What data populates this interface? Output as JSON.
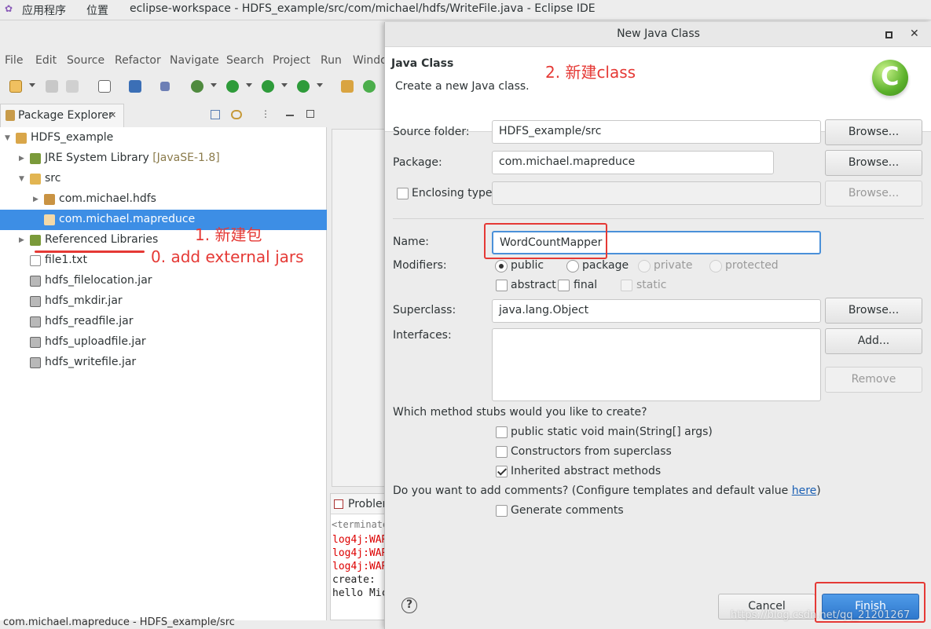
{
  "gnome": {
    "apps": "应用程序",
    "places": "位置",
    "window_title": "eclipse-workspace - HDFS_example/src/com/michael/hdfs/WriteFile.java - Eclipse IDE"
  },
  "menu": [
    "File",
    "Edit",
    "Source",
    "Refactor",
    "Navigate",
    "Search",
    "Project",
    "Run",
    "Windo"
  ],
  "package_explorer": {
    "tab_label": "Package Explorer",
    "tab_close": "✕",
    "tree": [
      {
        "label": "HDFS_example",
        "extra": "",
        "icon": "project-icon"
      },
      {
        "label": "JRE System Library",
        "extra": "[JavaSE-1.8]",
        "icon": "library-icon"
      },
      {
        "label": "src",
        "extra": "",
        "icon": "source-folder-icon"
      },
      {
        "label": "com.michael.hdfs",
        "extra": "",
        "icon": "package-icon"
      },
      {
        "label": "com.michael.mapreduce",
        "extra": "",
        "icon": "package-icon"
      },
      {
        "label": "Referenced Libraries",
        "extra": "",
        "icon": "library-icon"
      },
      {
        "label": "file1.txt",
        "extra": "",
        "icon": "file-icon"
      },
      {
        "label": "hdfs_filelocation.jar",
        "extra": "",
        "icon": "jar-icon"
      },
      {
        "label": "hdfs_mkdir.jar",
        "extra": "",
        "icon": "jar-icon"
      },
      {
        "label": "hdfs_readfile.jar",
        "extra": "",
        "icon": "jar-icon"
      },
      {
        "label": "hdfs_uploadfile.jar",
        "extra": "",
        "icon": "jar-icon"
      },
      {
        "label": "hdfs_writefile.jar",
        "extra": "",
        "icon": "jar-icon"
      }
    ]
  },
  "annotations": {
    "a1": "1. 新建包",
    "a0": "0. add external jars",
    "a2": "2. 新建class"
  },
  "console": {
    "tab_label": "Problen",
    "terminated": "<terminate",
    "lines": [
      "log4j:WAR",
      "log4j:WAR",
      "log4j:WAR",
      "create: ",
      "hello Mic"
    ]
  },
  "status_bar": "com.michael.mapreduce - HDFS_example/src",
  "dialog": {
    "title": "New Java Class",
    "header_title": "Java Class",
    "header_desc": "Create a new Java class.",
    "source_folder_label": "Source folder:",
    "source_folder_value": "HDFS_example/src",
    "package_label": "Package:",
    "package_value": "com.michael.mapreduce",
    "enclosing_label": "Enclosing type:",
    "browse": "Browse...",
    "name_label": "Name:",
    "name_value": "WordCountMapper",
    "modifiers_label": "Modifiers:",
    "mod_public": "public",
    "mod_package": "package",
    "mod_private": "private",
    "mod_protected": "protected",
    "mod_abstract": "abstract",
    "mod_final": "final",
    "mod_static": "static",
    "superclass_label": "Superclass:",
    "superclass_value": "java.lang.Object",
    "interfaces_label": "Interfaces:",
    "add": "Add...",
    "remove": "Remove",
    "stubs_question": "Which method stubs would you like to create?",
    "stub_main": "public static void main(String[] args)",
    "stub_constructors": "Constructors from superclass",
    "stub_inherited": "Inherited abstract methods",
    "comments_question": "Do you want to add comments? (Configure templates and default value ",
    "comments_link": "here",
    "comments_close": ")",
    "generate_comments": "Generate comments",
    "help": "?",
    "cancel": "Cancel",
    "finish": "Finish",
    "watermark": "https://blog.csdn.net/qq_21201267"
  }
}
